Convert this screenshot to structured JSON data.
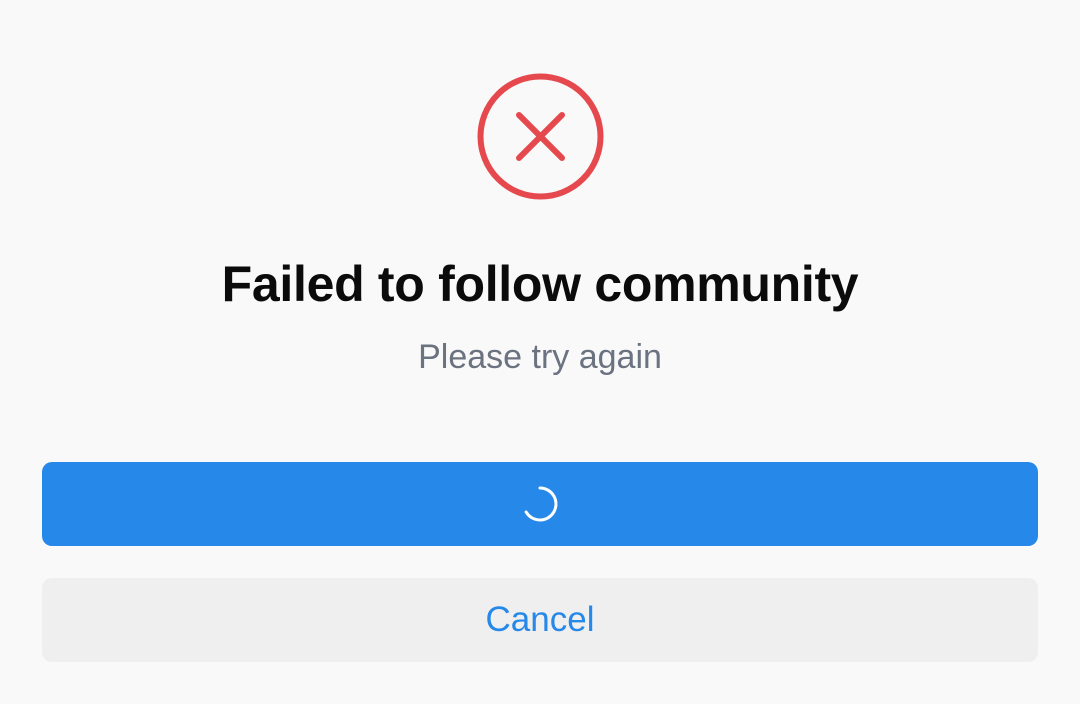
{
  "dialog": {
    "icon": "error-x-circle-icon",
    "title": "Failed to follow community",
    "subtitle": "Please try again",
    "retry_button": {
      "state": "loading",
      "icon": "loading-spinner-icon"
    },
    "cancel_label": "Cancel"
  },
  "colors": {
    "background": "#f9f9f9",
    "error": "#e5484d",
    "primary": "#2688e9",
    "title_text": "#0b0b0b",
    "subtitle_text": "#6b7280",
    "secondary_button_bg": "#efefef"
  }
}
